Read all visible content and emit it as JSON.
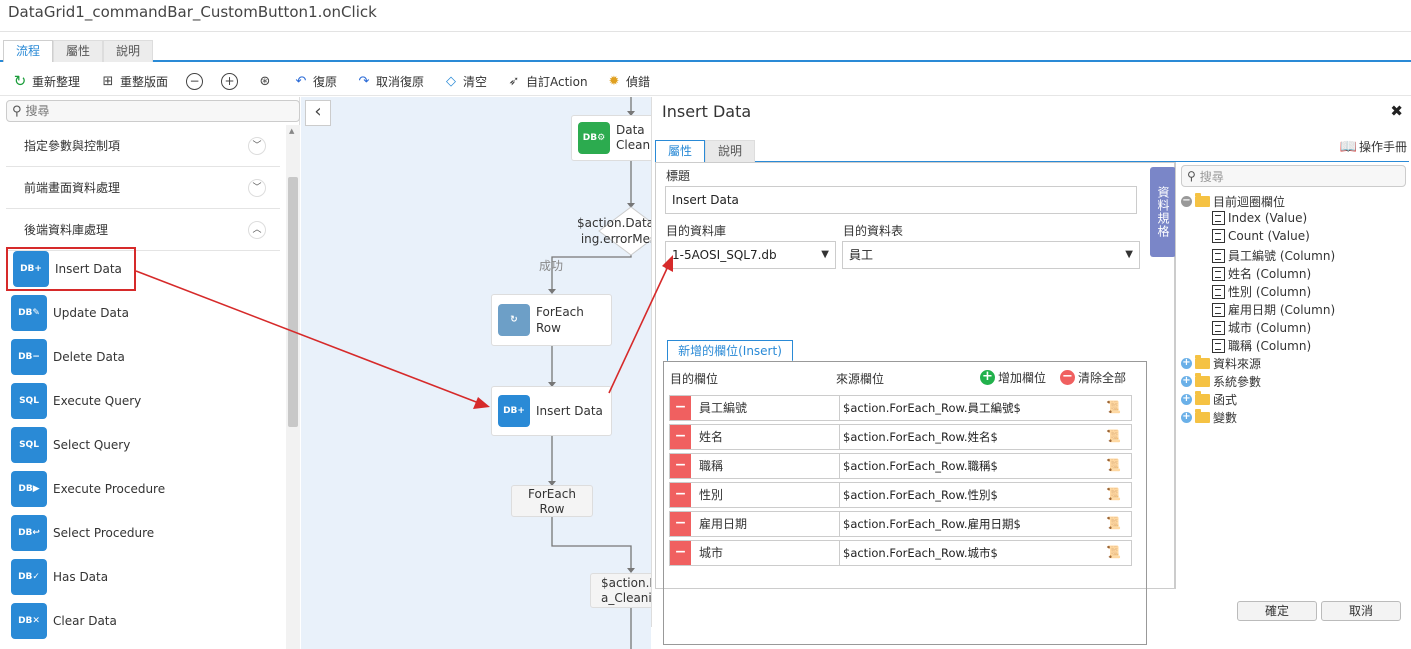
{
  "title": "DataGrid1_commandBar_CustomButton1.onClick",
  "top_tabs": [
    "流程",
    "屬性",
    "說明"
  ],
  "toolbar": {
    "reset_arrange": "重新整理",
    "reset_layout": "重整版面",
    "undo": "復原",
    "redo": "取消復原",
    "clear": "清空",
    "custom_action": "自訂Action",
    "debug": "偵錯"
  },
  "left": {
    "search_placeholder": "搜尋",
    "categories": [
      "指定參數與控制項",
      "前端畫面資料處理",
      "後端資料庫處理"
    ],
    "items": [
      {
        "label": "Insert Data",
        "icon": "insert-data-icon"
      },
      {
        "label": "Update Data",
        "icon": "update-data-icon"
      },
      {
        "label": "Delete Data",
        "icon": "delete-data-icon"
      },
      {
        "label": "Execute Query",
        "icon": "execute-query-icon"
      },
      {
        "label": "Select Query",
        "icon": "select-query-icon"
      },
      {
        "label": "Execute Procedure",
        "icon": "execute-procedure-icon"
      },
      {
        "label": "Select Procedure",
        "icon": "select-procedure-icon"
      },
      {
        "label": "Has Data",
        "icon": "has-data-icon"
      },
      {
        "label": "Clear Data",
        "icon": "clear-data-icon"
      }
    ]
  },
  "canvas": {
    "node_data_cleaning": {
      "line1": "Data",
      "line2": "Cleanin"
    },
    "decision": {
      "line1": "$action.Data_",
      "line2": "ing.errorMes"
    },
    "success_label": "成功",
    "node_foreach": {
      "line1": "ForEach",
      "line2": "Row"
    },
    "node_insert": "Insert Data",
    "node_foreach_end": {
      "line1": "ForEach",
      "line2": "Row"
    },
    "node_bottom": {
      "line1": "$action.D",
      "line2": "a_Cleanin"
    }
  },
  "dialog": {
    "title": "Insert Data",
    "tabs": [
      "屬性",
      "說明"
    ],
    "manual": "操作手冊",
    "label_title": "標題",
    "title_value": "Insert Data",
    "label_db": "目的資料庫",
    "db_value": "1-5AOSI_SQL7.db",
    "label_table": "目的資料表",
    "table_value": "員工",
    "insert_tab": "新增的欄位(Insert)",
    "head_target": "目的欄位",
    "head_source": "來源欄位",
    "add_field": "增加欄位",
    "clear_all": "清除全部",
    "rows": [
      {
        "target": "員工編號",
        "source": "$action.ForEach_Row.員工編號$"
      },
      {
        "target": "姓名",
        "source": "$action.ForEach_Row.姓名$"
      },
      {
        "target": "職稱",
        "source": "$action.ForEach_Row.職稱$"
      },
      {
        "target": "性別",
        "source": "$action.ForEach_Row.性別$"
      },
      {
        "target": "雇用日期",
        "source": "$action.ForEach_Row.雇用日期$"
      },
      {
        "target": "城市",
        "source": "$action.ForEach_Row.城市$"
      }
    ],
    "ds_tab": "資料規格",
    "tree_search_placeholder": "搜尋",
    "tree": {
      "root": "目前迴圈欄位",
      "children": [
        "Index (Value)",
        "Count (Value)",
        "員工編號 (Column)",
        "姓名 (Column)",
        "性別 (Column)",
        "雇用日期 (Column)",
        "城市 (Column)",
        "職稱 (Column)"
      ],
      "others": [
        "資料來源",
        "系統參數",
        "函式",
        "變數"
      ]
    },
    "ok": "確定",
    "cancel": "取消"
  },
  "colors": {
    "accent": "#2a8ad6",
    "danger": "#f06060",
    "add": "#22b14c",
    "highlight": "#d62a2a",
    "canvas_bg": "#e9f1fa"
  }
}
